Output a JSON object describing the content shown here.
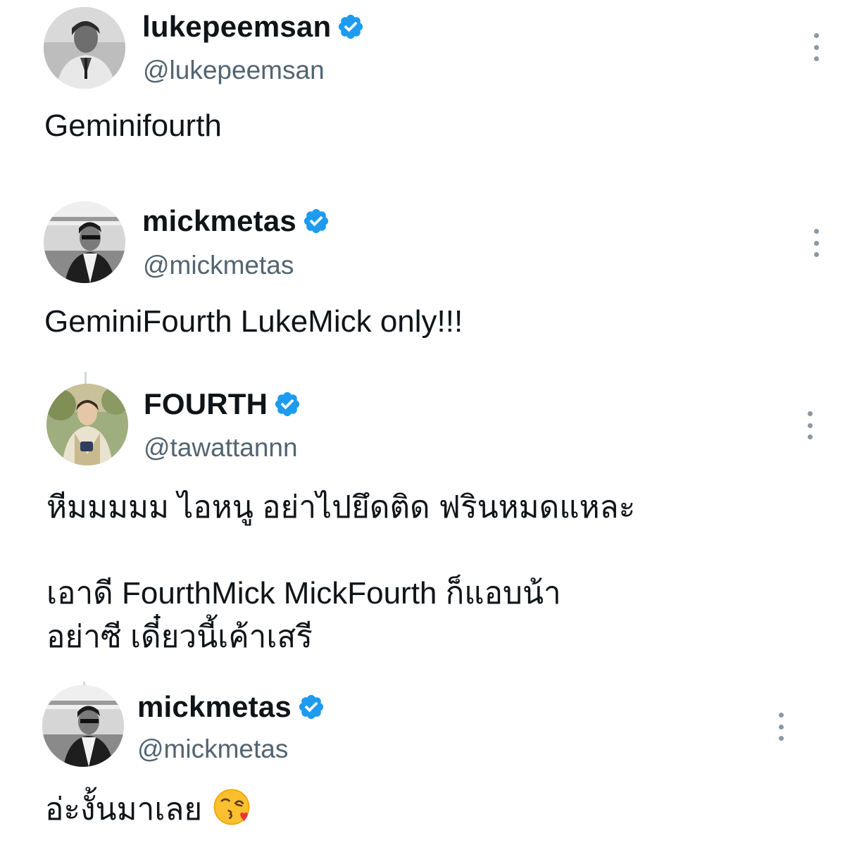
{
  "tweets": [
    {
      "display_name": "lukepeemsan",
      "handle": "@lukepeemsan",
      "verified": true,
      "text_lines": [
        "Geminifourth"
      ],
      "avatar_icon": "avatar-photo-grayscale"
    },
    {
      "display_name": "mickmetas",
      "handle": "@mickmetas",
      "verified": true,
      "text_lines": [
        "GeminiFourth LukeMick only!!!"
      ],
      "avatar_icon": "avatar-photo-grayscale"
    },
    {
      "display_name": "FOURTH",
      "handle": "@tawattannn",
      "verified": true,
      "text_lines": [
        "หีมมมมม ไอหนู อย่าไปยึดติด ฟรินหมดแหละ",
        "เอาดี FourthMick MickFourth ก็แอบน้า",
        "อย่าซี เดี๋ยวนี้เค้าเสรี"
      ],
      "avatar_icon": "avatar-photo-color"
    },
    {
      "display_name": "mickmetas",
      "handle": "@mickmetas",
      "verified": true,
      "text_lines": [
        "อ่ะงั้นมาเลย"
      ],
      "emoji": "kissing-face-with-heart-emoji",
      "avatar_icon": "avatar-photo-grayscale"
    }
  ],
  "colors": {
    "verified_blue": "#1d9bf0",
    "handle_gray": "#536471",
    "text": "#0f1419",
    "thread_line": "#cfd9de"
  }
}
